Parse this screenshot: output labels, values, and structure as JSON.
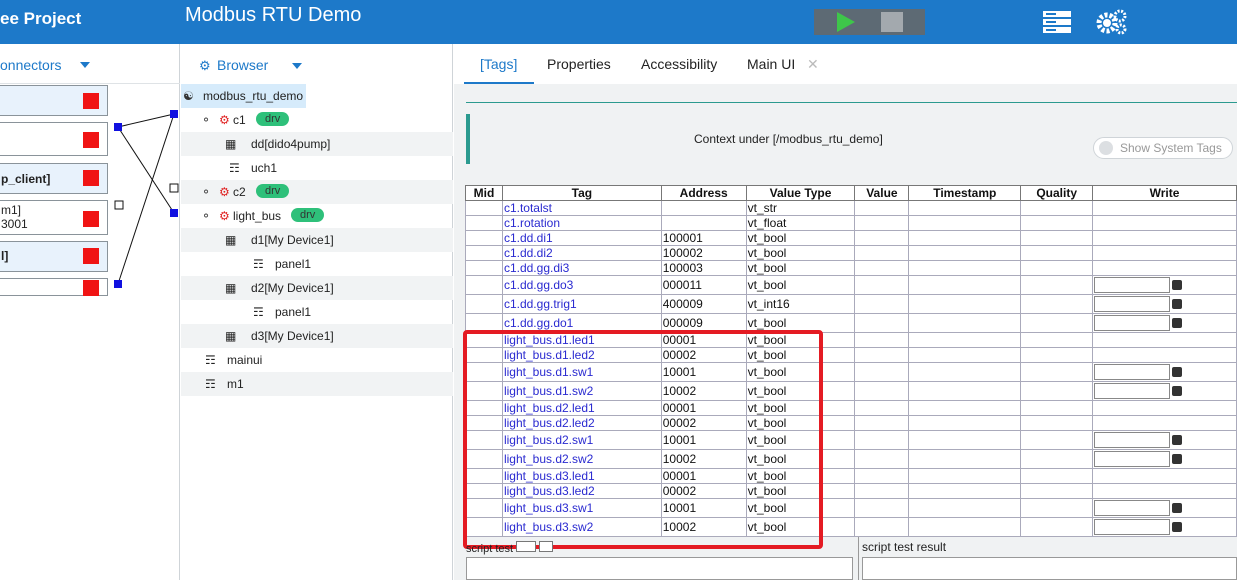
{
  "header": {
    "project_label": "ee Project",
    "app_title": "Modbus RTU Demo",
    "colors": {
      "bar": "#1d79c9",
      "play": "#3ec64a"
    }
  },
  "connectors": {
    "label": "onnectors",
    "items": [
      {
        "text": ""
      },
      {
        "text": ""
      },
      {
        "text": "p_client]"
      },
      {
        "text": "m1]",
        "text2": "3001"
      },
      {
        "text": "l]"
      },
      {
        "text": ""
      }
    ]
  },
  "browser": {
    "label": "Browser",
    "nodes": [
      {
        "label": "modbus_rtu_demo"
      },
      {
        "label": "c1",
        "badge": "drv"
      },
      {
        "label": "dd[dido4pump]"
      },
      {
        "label": "uch1"
      },
      {
        "label": "c2",
        "badge": "drv"
      },
      {
        "label": "light_bus",
        "badge": "drv"
      },
      {
        "label": "d1[My Device1]"
      },
      {
        "label": "panel1"
      },
      {
        "label": "d2[My Device1]"
      },
      {
        "label": "panel1"
      },
      {
        "label": "d3[My Device1]"
      },
      {
        "label": "mainui"
      },
      {
        "label": "m1"
      }
    ]
  },
  "tabs": [
    {
      "label": "[Tags]"
    },
    {
      "label": "Properties"
    },
    {
      "label": "Accessibility"
    },
    {
      "label": "Main UI"
    }
  ],
  "context": {
    "text": "Context under [/modbus_rtu_demo]",
    "system_tags": "Show System Tags"
  },
  "table": {
    "headers": [
      "Mid",
      "Tag",
      "Address",
      "Value Type",
      "Value",
      "Timestamp",
      "Quality",
      "Write"
    ],
    "rows": [
      {
        "tag": "c1.totalst",
        "addr": "",
        "type": "vt_str"
      },
      {
        "tag": "c1.rotation",
        "addr": "",
        "type": "vt_float"
      },
      {
        "tag": "c1.dd.di1",
        "addr": "100001",
        "type": "vt_bool"
      },
      {
        "tag": "c1.dd.di2",
        "addr": "100002",
        "type": "vt_bool"
      },
      {
        "tag": "c1.dd.gg.di3",
        "addr": "100003",
        "type": "vt_bool"
      },
      {
        "tag": "c1.dd.gg.do3",
        "addr": "000011",
        "type": "vt_bool"
      },
      {
        "tag": "c1.dd.gg.trig1",
        "addr": "400009",
        "type": "vt_int16"
      },
      {
        "tag": "c1.dd.gg.do1",
        "addr": "000009",
        "type": "vt_bool"
      },
      {
        "tag": "light_bus.d1.led1",
        "addr": "00001",
        "type": "vt_bool"
      },
      {
        "tag": "light_bus.d1.led2",
        "addr": "00002",
        "type": "vt_bool"
      },
      {
        "tag": "light_bus.d1.sw1",
        "addr": "10001",
        "type": "vt_bool"
      },
      {
        "tag": "light_bus.d1.sw2",
        "addr": "10002",
        "type": "vt_bool"
      },
      {
        "tag": "light_bus.d2.led1",
        "addr": "00001",
        "type": "vt_bool"
      },
      {
        "tag": "light_bus.d2.led2",
        "addr": "00002",
        "type": "vt_bool"
      },
      {
        "tag": "light_bus.d2.sw1",
        "addr": "10001",
        "type": "vt_bool"
      },
      {
        "tag": "light_bus.d2.sw2",
        "addr": "10002",
        "type": "vt_bool"
      },
      {
        "tag": "light_bus.d3.led1",
        "addr": "00001",
        "type": "vt_bool"
      },
      {
        "tag": "light_bus.d3.led2",
        "addr": "00002",
        "type": "vt_bool"
      },
      {
        "tag": "light_bus.d3.sw1",
        "addr": "10001",
        "type": "vt_bool"
      },
      {
        "tag": "light_bus.d3.sw2",
        "addr": "10002",
        "type": "vt_bool"
      }
    ]
  },
  "script": {
    "test_label": "script test",
    "result_label": "script test result"
  }
}
